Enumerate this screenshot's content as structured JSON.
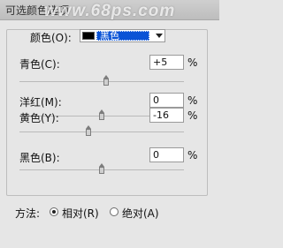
{
  "window": {
    "title": "可选颜色选项",
    "watermark": "www.68ps.com"
  },
  "colors": {
    "label": "颜色(O):",
    "selected": "黑色",
    "swatch_color": "#000000"
  },
  "adjustments": [
    {
      "label": "青色(C):",
      "value": "+5",
      "unit": "%",
      "level": 5
    },
    {
      "label": "洋红(M):",
      "value": "0",
      "unit": "%",
      "level": 0
    },
    {
      "label": "黄色(Y):",
      "value": "-16",
      "unit": "%",
      "level": -16
    },
    {
      "label": "黑色(B):",
      "value": "0",
      "unit": "%",
      "level": 0
    }
  ],
  "method": {
    "label": "方法:",
    "options": [
      {
        "label": "相对(R)",
        "selected": true
      },
      {
        "label": "绝对(A)",
        "selected": false
      }
    ]
  }
}
